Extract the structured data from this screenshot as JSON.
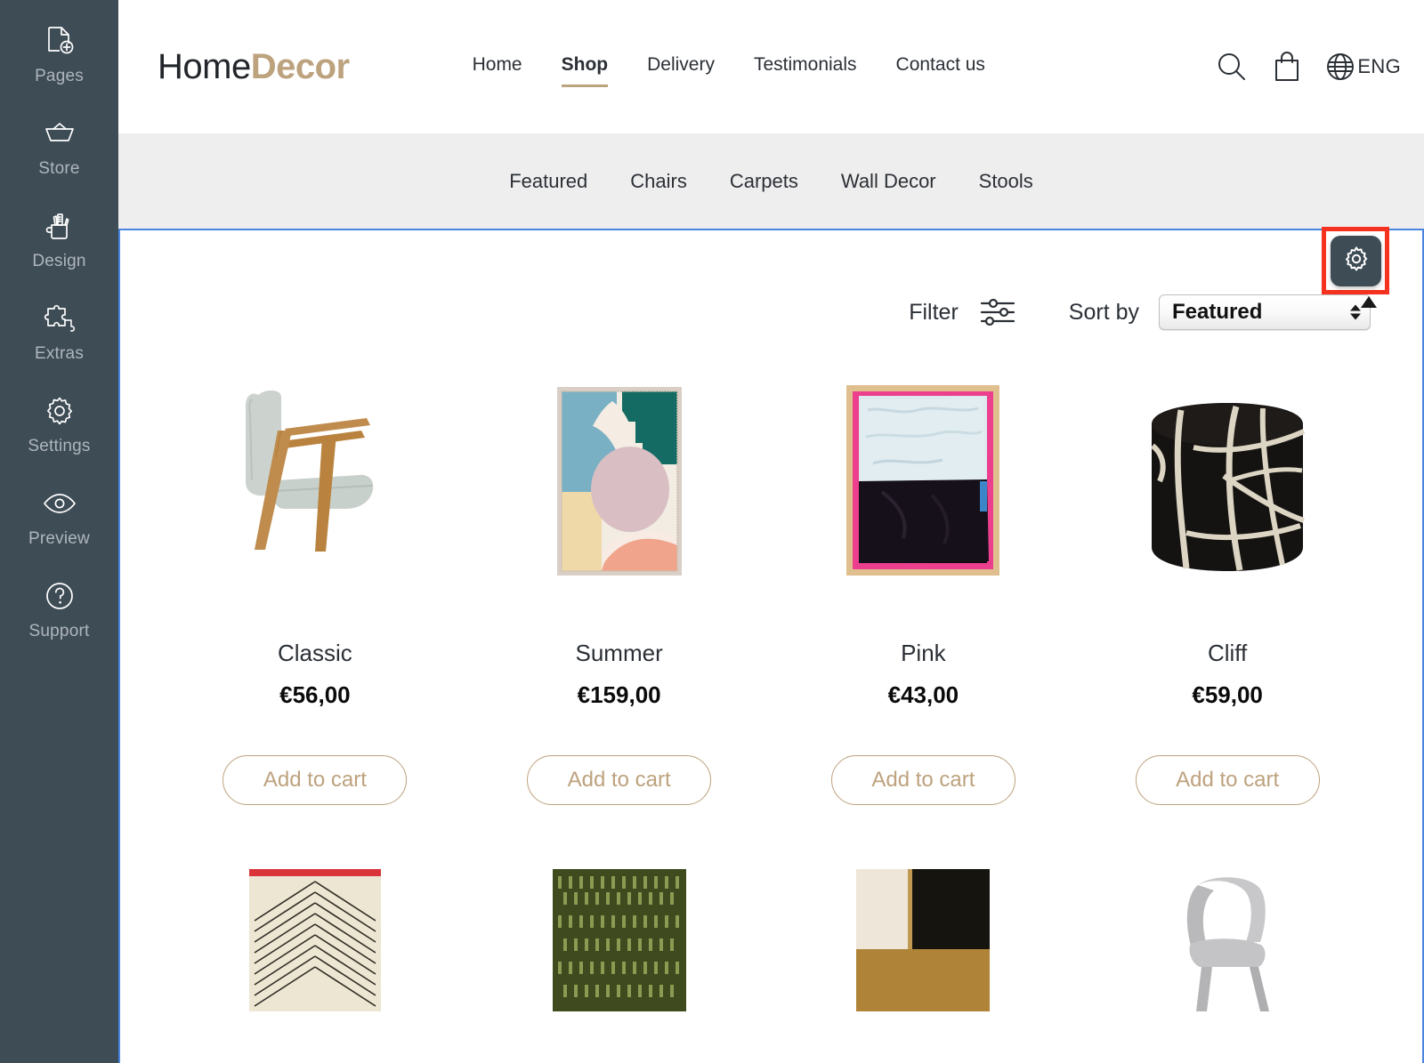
{
  "sidebar": {
    "items": [
      {
        "label": "Pages",
        "icon": "page-add-icon"
      },
      {
        "label": "Store",
        "icon": "basket-icon"
      },
      {
        "label": "Design",
        "icon": "design-cup-icon"
      },
      {
        "label": "Extras",
        "icon": "puzzle-icon"
      },
      {
        "label": "Settings",
        "icon": "gear-icon"
      },
      {
        "label": "Preview",
        "icon": "eye-icon"
      },
      {
        "label": "Support",
        "icon": "question-circle-icon"
      }
    ]
  },
  "site": {
    "logo": {
      "part1": "Home",
      "part2": "Decor",
      "accent": "#bda27e"
    },
    "nav": [
      {
        "label": "Home",
        "active": false
      },
      {
        "label": "Shop",
        "active": true
      },
      {
        "label": "Delivery",
        "active": false
      },
      {
        "label": "Testimonials",
        "active": false
      },
      {
        "label": "Contact us",
        "active": false
      }
    ],
    "tools": {
      "search": "search-icon",
      "cart": "shopping-bag-icon",
      "globe": "globe-icon",
      "language": "ENG"
    },
    "categories": [
      "Featured",
      "Chairs",
      "Carpets",
      "Wall Decor",
      "Stools"
    ]
  },
  "toolbar": {
    "filter_label": "Filter",
    "filter_icon": "sliders-icon",
    "sortby_label": "Sort by",
    "sort_value": "Featured",
    "sort_options": [
      "Featured"
    ]
  },
  "products": {
    "row1": [
      {
        "name": "Classic",
        "price": "€56,00",
        "cart": "Add to cart"
      },
      {
        "name": "Summer",
        "price": "€159,00",
        "cart": "Add to cart"
      },
      {
        "name": "Pink",
        "price": "€43,00",
        "cart": "Add to cart"
      },
      {
        "name": "Cliff",
        "price": "€59,00",
        "cart": "Add to cart"
      }
    ]
  },
  "overlay": {
    "gear_button": "gear-icon",
    "highlight_color": "#f5321f"
  }
}
